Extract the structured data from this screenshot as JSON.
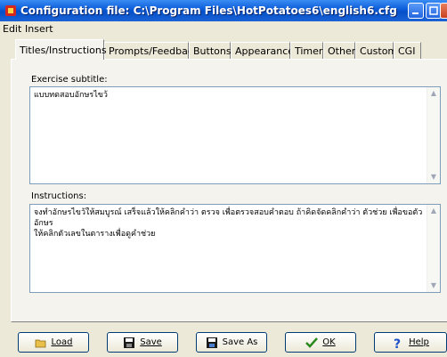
{
  "window": {
    "title": "Configuration file: C:\\Program Files\\HotPotatoes6\\english6.cfg"
  },
  "menu": [
    {
      "label": "Edit"
    },
    {
      "label": "Insert"
    }
  ],
  "tabs": [
    {
      "label": "Titles/Instructions",
      "active": true
    },
    {
      "label": "Prompts/Feedback",
      "active": false
    },
    {
      "label": "Buttons",
      "active": false
    },
    {
      "label": "Appearance",
      "active": false
    },
    {
      "label": "Timer",
      "active": false
    },
    {
      "label": "Other",
      "active": false
    },
    {
      "label": "Custom",
      "active": false
    },
    {
      "label": "CGI",
      "active": false
    }
  ],
  "fields": {
    "subtitle_label": "Exercise subtitle:",
    "subtitle_value": "แบบทดสอบอักษรไขว้",
    "instructions_label": "Instructions:",
    "instructions_line1": "จงทำอักษรไขว้ให้สมบูรณ์ เสร็จแล้วให้คลิกคำว่า ตรวจ เพื่อตรวจสอบคำตอบ ถ้าคิดจัดคลิกคำว่า ตัวช่วย เพื่อขอตัวอักษร",
    "instructions_line2": "ให้คลิกตัวเลขในตารางเพื่อดูคำช่วย"
  },
  "buttons": {
    "load": "Load",
    "save": "Save",
    "save_as": "Save As",
    "ok": "OK",
    "help": "Help"
  },
  "colors": {
    "titlebar": "#0a5bd8",
    "face": "#ece9d8",
    "panel": "#f4f3ee",
    "ok_check": "#2a8a1e",
    "help_icon": "#1d50c8"
  }
}
